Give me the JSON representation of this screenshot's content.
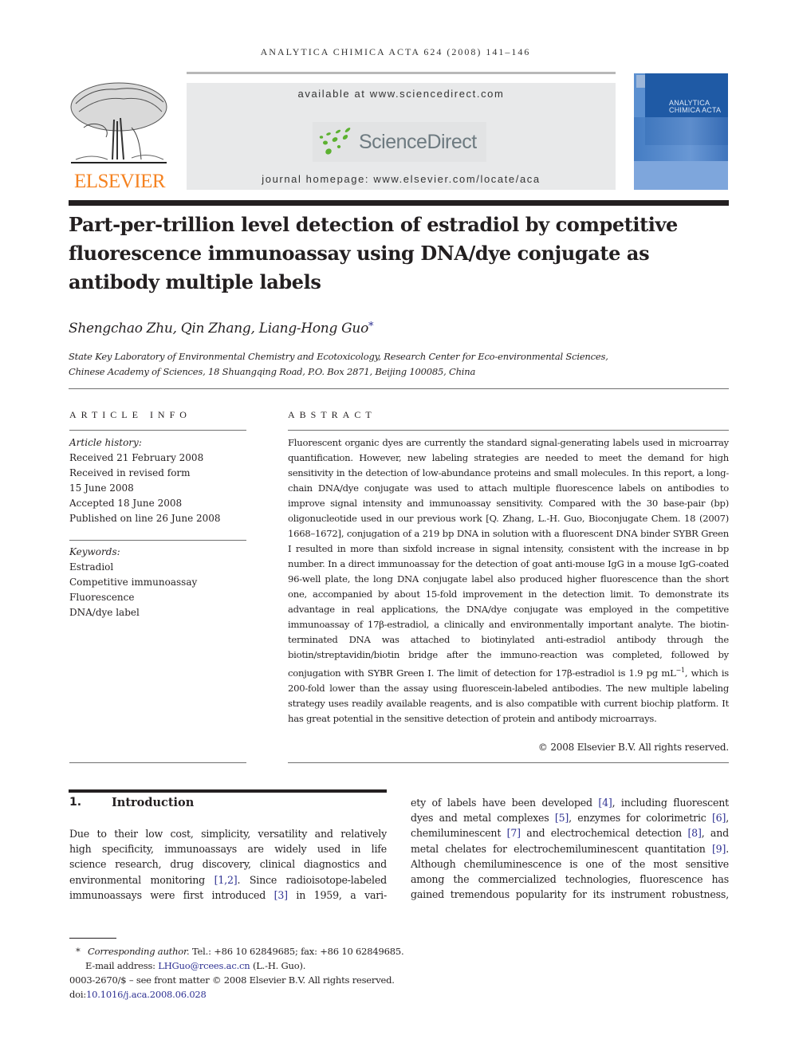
{
  "header": {
    "running_head": "ANALYTICA CHIMICA ACTA 624 (2008) 141–146",
    "publisher_logo_text": "ELSEVIER",
    "available_at": "available at www.sciencedirect.com",
    "sciencedirect_logo_text": "ScienceDirect",
    "journal_homepage": "journal homepage: www.elsevier.com/locate/aca",
    "cover_title_line1": "ANALYTICA",
    "cover_title_line2": "CHIMICA ACTA",
    "colors": {
      "elsevier_orange": "#f58220",
      "sciencedirect_green": "#5cb130",
      "link_blue": "#2e3192"
    }
  },
  "article": {
    "title": "Part-per-trillion level detection of estradiol by competitive fluorescence immunoassay using DNA/dye conjugate as antibody multiple labels",
    "authors": "Shengchao Zhu, Qin Zhang, Liang-Hong Guo",
    "author_marker": "*",
    "affiliation_line1": "State Key Laboratory of Environmental Chemistry and Ecotoxicology, Research Center for Eco-environmental Sciences,",
    "affiliation_line2": "Chinese Academy of Sciences, 18 Shuangqing Road, P.O. Box 2871, Beijing 100085, China"
  },
  "article_info": {
    "heading": "ARTICLE INFO",
    "history_label": "Article history:",
    "history": [
      "Received 21 February 2008",
      "Received in revised form",
      "15 June 2008",
      "Accepted 18 June 2008",
      "Published on line 26 June 2008"
    ],
    "keywords_label": "Keywords:",
    "keywords": [
      "Estradiol",
      "Competitive immunoassay",
      "Fluorescence",
      "DNA/dye label"
    ]
  },
  "abstract": {
    "heading": "ABSTRACT",
    "text_part1": "Fluorescent organic dyes are currently the standard signal-generating labels used in microarray quantification. However, new labeling strategies are needed to meet the demand for high sensitivity in the detection of low-abundance proteins and small molecules. In this report, a long-chain DNA/dye conjugate was used to attach multiple fluorescence labels on antibodies to improve signal intensity and immunoassay sensitivity. Compared with the 30 base-pair (bp) oligonucleotide used in our previous work [Q. Zhang, L.-H. Guo, Bioconjugate Chem. 18 (2007) 1668–1672], conjugation of a 219 bp DNA in solution with a fluorescent DNA binder SYBR Green I resulted in more than sixfold increase in signal intensity, consistent with the increase in bp number. In a direct immunoassay for the detection of goat anti-mouse IgG in a mouse IgG-coated 96-well plate, the long DNA conjugate label also produced higher fluorescence than the short one, accompanied by about 15-fold improvement in the detection limit. To demonstrate its advantage in real applications, the DNA/dye conjugate was employed in the competitive immunoassay of 17β-estradiol, a clinically and environmentally important analyte. The biotin-terminated DNA was attached to biotinylated anti-estradiol antibody through the biotin/streptavidin/biotin bridge after the immuno-reaction was completed, followed by conjugation with SYBR Green I. The limit of detection for 17β-estradiol is 1.9 pg mL",
    "superscript": "−1",
    "text_part2": ", which is 200-fold lower than the assay using fluorescein-labeled antibodies. The new multiple labeling strategy uses readily available reagents, and is also compatible with current biochip platform. It has great potential in the sensitive detection of protein and antibody microarrays.",
    "copyright": "© 2008 Elsevier B.V. All rights reserved."
  },
  "introduction": {
    "number": "1.",
    "title": "Introduction",
    "left_column": [
      [
        {
          "t": "Due to their low cost, simplicity, versatility and relatively"
        }
      ],
      [
        {
          "t": "high specificity, immunoassays are widely used in life"
        }
      ],
      [
        {
          "t": "science research, drug discovery, clinical diagnostics and"
        }
      ],
      [
        {
          "t": "environmental monitoring "
        },
        {
          "t": "[1,2]",
          "ref": true
        },
        {
          "t": ". Since radioisotope-labeled"
        }
      ],
      [
        {
          "t": "immunoassays were first introduced "
        },
        {
          "t": "[3]",
          "ref": true
        },
        {
          "t": " in 1959, a vari-"
        }
      ]
    ],
    "right_column": [
      [
        {
          "t": "ety of labels have been developed "
        },
        {
          "t": "[4]",
          "ref": true
        },
        {
          "t": ", including fluorescent"
        }
      ],
      [
        {
          "t": "dyes and metal complexes "
        },
        {
          "t": "[5]",
          "ref": true
        },
        {
          "t": ", enzymes for colorimetric "
        },
        {
          "t": "[6]",
          "ref": true
        },
        {
          "t": ","
        }
      ],
      [
        {
          "t": "chemiluminescent "
        },
        {
          "t": "[7]",
          "ref": true
        },
        {
          "t": " and electrochemical detection "
        },
        {
          "t": "[8]",
          "ref": true
        },
        {
          "t": ", and"
        }
      ],
      [
        {
          "t": "metal chelates for electrochemiluminescent quantitation "
        },
        {
          "t": "[9]",
          "ref": true
        },
        {
          "t": "."
        }
      ],
      [
        {
          "t": "Although chemiluminescence is one of the most sensitive"
        }
      ],
      [
        {
          "t": "among the commercialized technologies, fluorescence has"
        }
      ],
      [
        {
          "t": "gained tremendous popularity for its instrument robustness,"
        }
      ]
    ]
  },
  "footnotes": {
    "marker": "*",
    "corresponding_label": "Corresponding author.",
    "contact": " Tel.: +86 10 62849685; fax: +86 10 62849685.",
    "email_label": "E-mail address: ",
    "email": "LHGuo@rcees.ac.cn",
    "email_suffix": " (L.-H. Guo).",
    "issn_line": "0003-2670/$ – see front matter © 2008 Elsevier B.V. All rights reserved.",
    "doi_label": "doi:",
    "doi": "10.1016/j.aca.2008.06.028"
  }
}
